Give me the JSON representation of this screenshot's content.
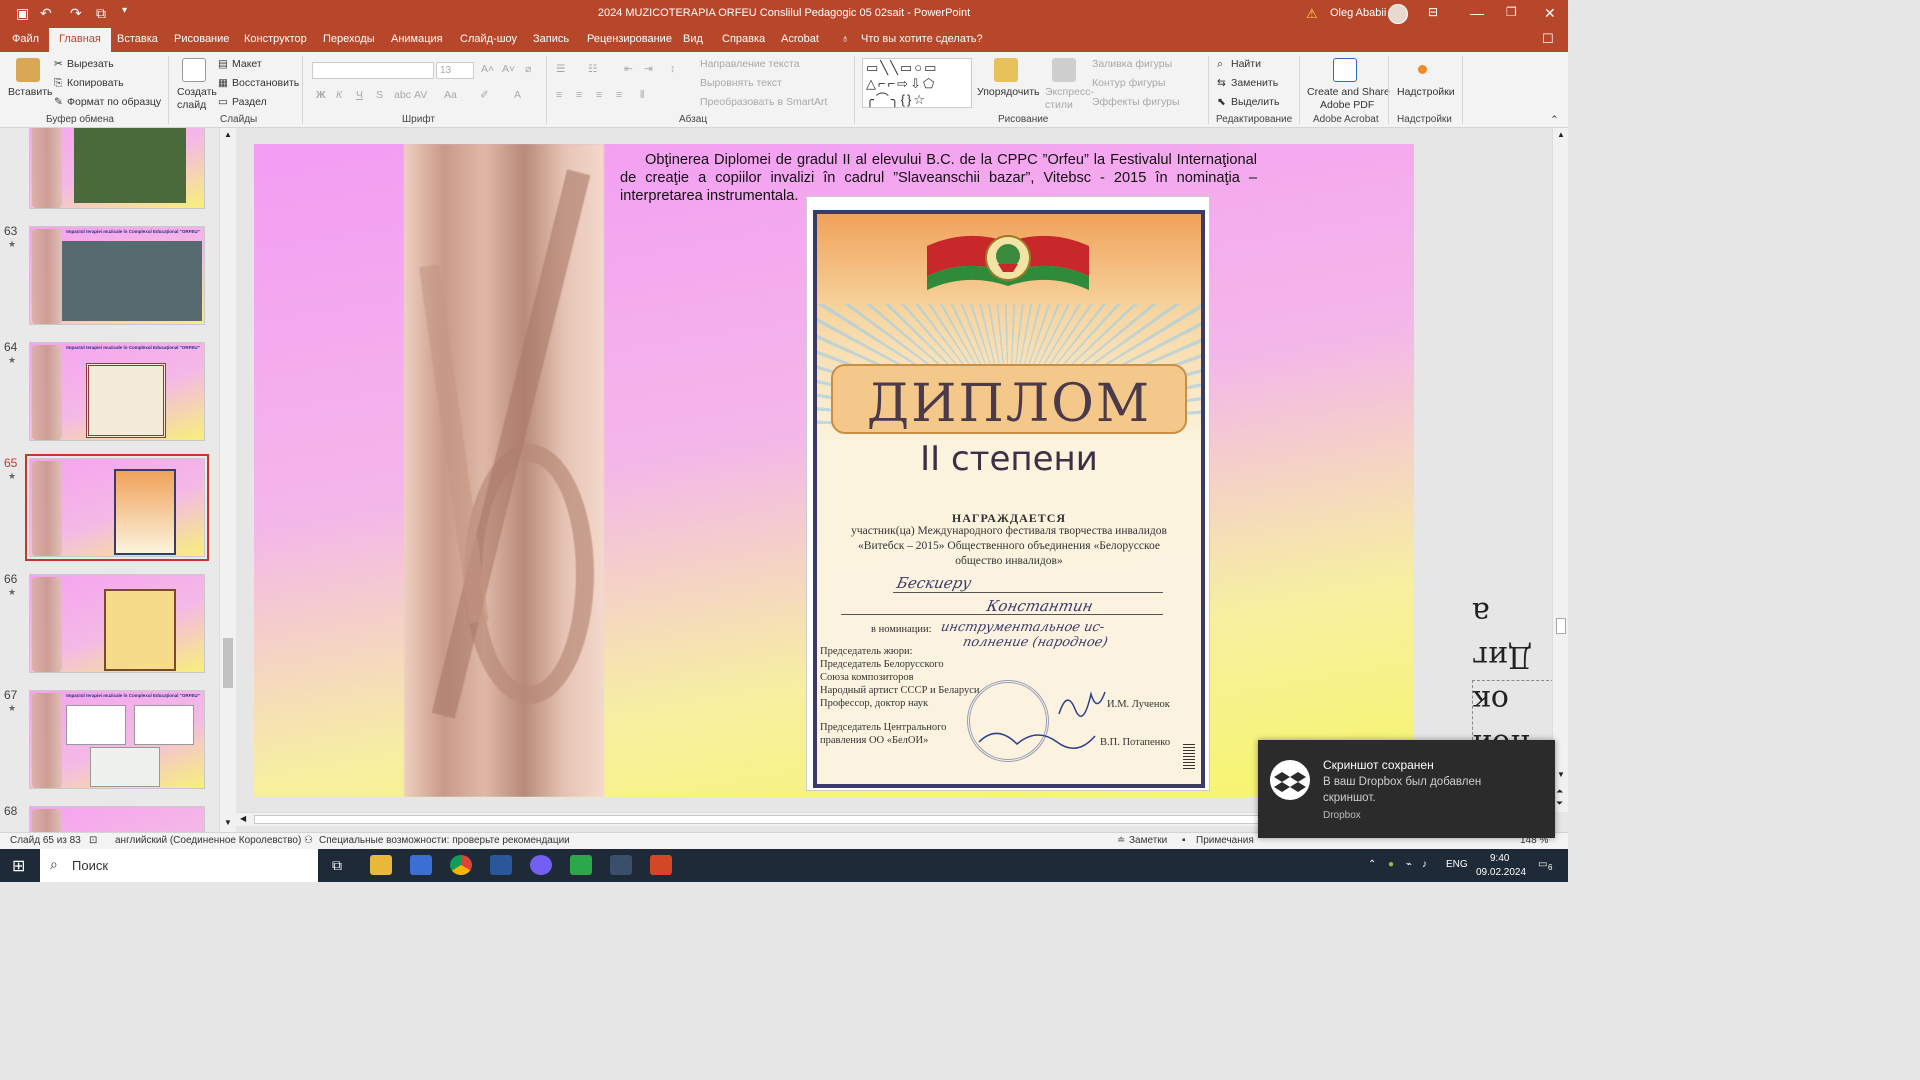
{
  "titlebar": {
    "doc_title": "2024 MUZICOTERAPIA ORFEU Conslilul Pedagogic 05 02sait  -  PowerPoint",
    "user": "Oleg Ababii",
    "warning_icon": "warning-icon"
  },
  "menu": {
    "tabs": [
      "Файл",
      "Главная",
      "Вставка",
      "Рисование",
      "Конструктор",
      "Переходы",
      "Анимация",
      "Слайд-шоу",
      "Запись",
      "Рецензирование",
      "Вид",
      "Справка",
      "Acrobat"
    ],
    "tellme": "Что вы хотите сделать?"
  },
  "ribbon": {
    "clipboard": {
      "paste": "Вставить",
      "cut": "Вырезать",
      "copy": "Копировать",
      "format": "Формат по образцу",
      "label": "Буфер обмена"
    },
    "slides": {
      "create": "Создать",
      "create2": "слайд",
      "layout": "Макет",
      "reset": "Восстановить",
      "section": "Раздел",
      "label": "Слайды"
    },
    "font": {
      "size": "13",
      "label": "Шрифт",
      "bold": "Ж",
      "italic": "К",
      "underline": "Ч",
      "strike": "S",
      "case": "Aa"
    },
    "paragraph": {
      "direction": "Направление текста",
      "align": "Выровнять текст",
      "smartart": "Преобразовать в SmartArt",
      "label": "Абзац"
    },
    "drawing": {
      "arrange": "Упорядочить",
      "styles": "Экспресс-",
      "styles2": "стили",
      "fill": "Заливка фигуры",
      "outline": "Контур фигуры",
      "effects": "Эффекты фигуры",
      "label": "Рисование"
    },
    "editing": {
      "find": "Найти",
      "replace": "Заменить",
      "select": "Выделить",
      "label": "Редактирование"
    },
    "acrobat": {
      "create": "Create and Share",
      "create2": "Adobe PDF",
      "label": "Adobe Acrobat"
    },
    "addins": {
      "btn": "Надстройки",
      "label": "Надстройки"
    }
  },
  "thumbnails": [
    {
      "num": "",
      "title": ""
    },
    {
      "num": "63",
      "title": "Impactul terapiei muzicale în Complexul Educaţional \"ORFEU\""
    },
    {
      "num": "64",
      "title": "Impactul terapiei muzicale în Complexul Educaţional \"ORFEU\""
    },
    {
      "num": "65",
      "title": ""
    },
    {
      "num": "66",
      "title": ""
    },
    {
      "num": "67",
      "title": "Impactul terapiei muzicale în Complexul Educaţional \"ORFEU\""
    },
    {
      "num": "68",
      "title": ""
    }
  ],
  "slide": {
    "text": "Obţinerea Diplomei de gradul II al elevului B.C. de la CPPC ”Orfeu” la Festivalul Internaţional de creaţie a copiilor invalizi în cadrul ”Slaveanschii bazar”, Vitebsc - 2015 în nominaţia – interpretarea instrumentala.",
    "diploma": {
      "title": "ДИПЛОМ",
      "subtitle": "II степени",
      "award": "НАГРАЖДАЕТСЯ",
      "desc": "участник(ца) Международного фестиваля творчества инвалидов «Витебск – 2015» Общественного объединения «Белорусское общество инвалидов»",
      "name1": "Бескиеру",
      "name2": "Константин",
      "nomination_label": "в номинации:",
      "nomination1": "инструментальное ис-",
      "nomination2": "полнение (народное)",
      "jury": [
        "Председатель жюри:",
        "Председатель Белорусского",
        "Союза композиторов",
        "Народный артист СССР и Беларуси",
        "Профессор, доктор наук"
      ],
      "jury_name": "И.М. Лученок",
      "chair": [
        "Председатель Центрального",
        "правления ОО «БелОИ»"
      ],
      "chair_name": "В.П. Потапенко"
    },
    "right_text": [
      "а",
      "Диг",
      "ок",
      "пой"
    ]
  },
  "status": {
    "slide": "Слайд 65 из 83",
    "lang": "английский (Соединенное Королевство)",
    "access": "Специальные возможности: проверьте рекомендации",
    "notes": "Заметки",
    "comments": "Примечания",
    "zoom": "148 %"
  },
  "toast": {
    "title": "Скриншот сохранен",
    "body": "В ваш Dropbox был добавлен скриншот.",
    "app": "Dropbox"
  },
  "taskbar": {
    "search": "Поиск",
    "lang": "ENG",
    "time": "9:40",
    "date": "09.02.2024",
    "notif": "6"
  },
  "colors": {
    "accent": "#b7472a",
    "selected_thumb": "#c0392b"
  }
}
